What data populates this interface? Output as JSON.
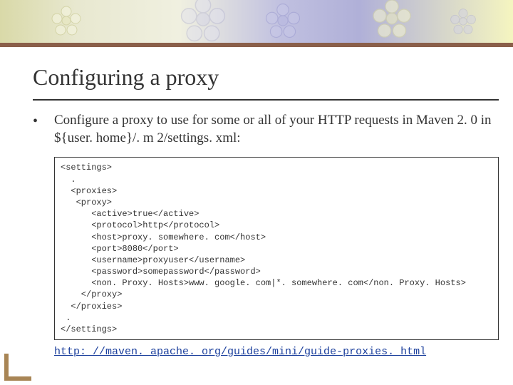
{
  "title": "Configuring a proxy",
  "bullet": "Configure a proxy to use for some or all of your HTTP requests in Maven 2. 0 in ${user. home}/. m 2/settings. xml:",
  "code_lines": [
    "<settings>",
    "  .",
    "  <proxies>",
    "   <proxy>",
    "      <active>true</active>",
    "      <protocol>http</protocol>",
    "      <host>proxy. somewhere. com</host>",
    "      <port>8080</port>",
    "      <username>proxyuser</username>",
    "      <password>somepassword</password>",
    "      <non. Proxy. Hosts>www. google. com|*. somewhere. com</non. Proxy. Hosts>",
    "    </proxy>",
    "  </proxies>",
    " .",
    "</settings>"
  ],
  "link": "http: //maven. apache. org/guides/mini/guide-proxies. html"
}
